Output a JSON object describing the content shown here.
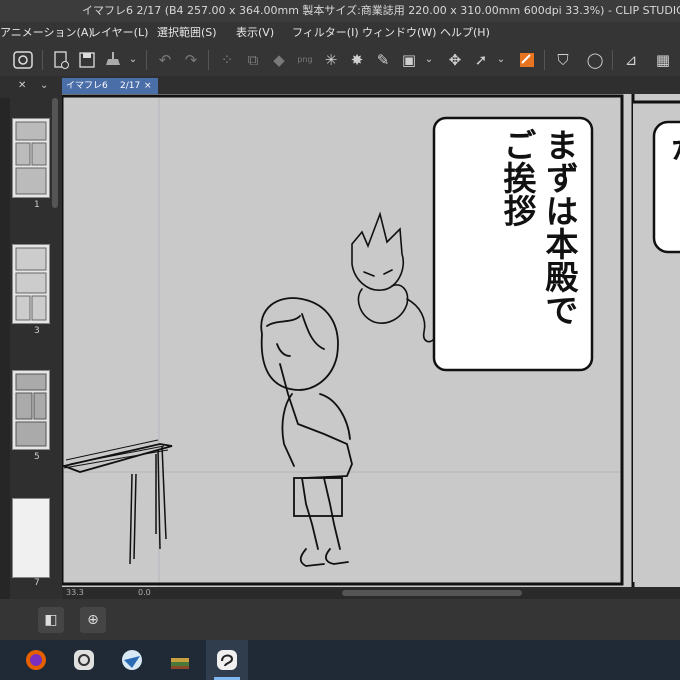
{
  "window": {
    "title": "イマフレ6 2/17 (B4 257.00 x 364.00mm 製本サイズ:商業誌用 220.00 x 310.00mm 600dpi 33.3%) - CLIP STUDIO PAINT EX"
  },
  "menu": {
    "items": [
      "アニメーション(A)",
      "レイヤー(L)",
      "選択範囲(S)",
      "表示(V)",
      "フィルター(I)",
      "ウィンドウ(W)",
      "ヘルプ(H)"
    ]
  },
  "toolbar": {
    "icons": [
      "clip-logo-icon",
      "new-icon",
      "save-icon",
      "export-icon",
      "undo-icon",
      "redo-icon",
      "deselect-icon",
      "crop-icon",
      "fill-icon",
      "png-icon",
      "sparkle-icon",
      "eyedropper-icon",
      "canvas-icon",
      "transform-icon",
      "cube-icon",
      "fill-orange-icon",
      "bucket-icon",
      "lasso-icon",
      "ruler-icon",
      "grid-icon"
    ]
  },
  "document_tab": {
    "name": "イマフレ6",
    "page": "2/17",
    "close": "×"
  },
  "pages_panel": {
    "numbers": [
      "1",
      "3",
      "5",
      "7"
    ]
  },
  "canvas": {
    "speech_balloon_left": {
      "lines": [
        "まずは本殿で",
        "ご挨拶"
      ]
    },
    "speech_balloon_right": {
      "visible_text": "か"
    }
  },
  "status": {
    "zoom": "33.3",
    "rotation": "0.0"
  },
  "taskbar": {
    "apps": [
      "firefox-icon",
      "clip-studio-icon",
      "app-icon",
      "books-icon",
      "clip-studio-paint-icon"
    ]
  },
  "colors": {
    "accent": "#4a6ea8",
    "canvas": "#c9c9c9"
  }
}
